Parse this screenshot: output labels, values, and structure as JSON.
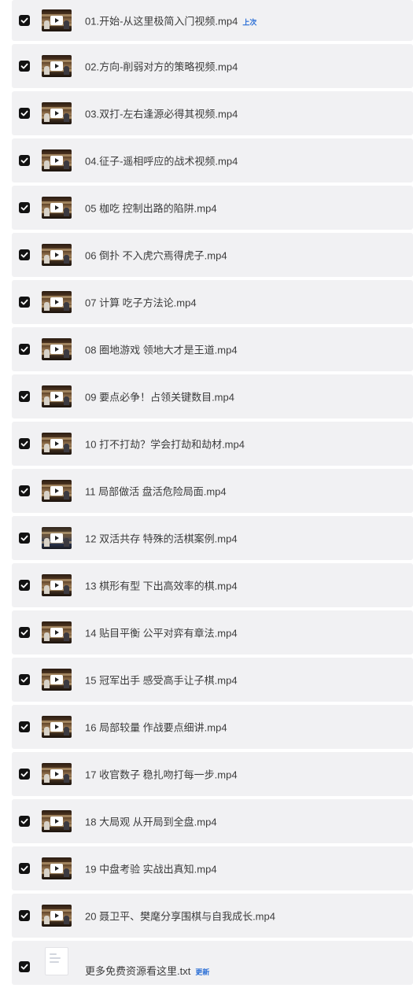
{
  "files": [
    {
      "name": "01.开始-从这里极简入门视频.mp4",
      "badge": "上次",
      "thumb": "video"
    },
    {
      "name": "02.方向-削弱对方的策略视频.mp4",
      "thumb": "video"
    },
    {
      "name": "03.双打-左右逢源必得其视频.mp4",
      "thumb": "video"
    },
    {
      "name": "04.征子-遥相呼应的战术视频.mp4",
      "thumb": "video"
    },
    {
      "name": "05 枷吃 控制出路的陷阱.mp4",
      "thumb": "video"
    },
    {
      "name": "06 倒扑 不入虎穴焉得虎子.mp4",
      "thumb": "video"
    },
    {
      "name": "07 计算 吃子方法论.mp4",
      "thumb": "video"
    },
    {
      "name": "08 圈地游戏 领地大才是王道.mp4",
      "thumb": "video"
    },
    {
      "name": "09 要点必争！占领关键数目.mp4",
      "thumb": "video"
    },
    {
      "name": "10 打不打劫？学会打劫和劫材.mp4",
      "thumb": "video"
    },
    {
      "name": "11 局部做活 盘活危险局面.mp4",
      "thumb": "video"
    },
    {
      "name": "12 双活共存 特殊的活棋案例.mp4",
      "thumb": "video-alt"
    },
    {
      "name": "13 棋形有型 下出高效率的棋.mp4",
      "thumb": "video"
    },
    {
      "name": "14 贴目平衡 公平对弈有章法.mp4",
      "thumb": "video"
    },
    {
      "name": "15 冠军出手 感受高手让子棋.mp4",
      "thumb": "video"
    },
    {
      "name": "16 局部较量 作战要点细讲.mp4",
      "thumb": "video"
    },
    {
      "name": "17 收官数子 稳扎吻打每一步.mp4",
      "thumb": "video"
    },
    {
      "name": "18 大局观 从开局到全盘.mp4",
      "thumb": "video"
    },
    {
      "name": "19 中盘考验 实战出真知.mp4",
      "thumb": "video"
    },
    {
      "name": "20 聂卫平、樊麾分享围棋与自我成长.mp4",
      "thumb": "video"
    },
    {
      "name": "更多免费资源看这里.txt",
      "badge": "更新",
      "thumb": "document"
    }
  ]
}
